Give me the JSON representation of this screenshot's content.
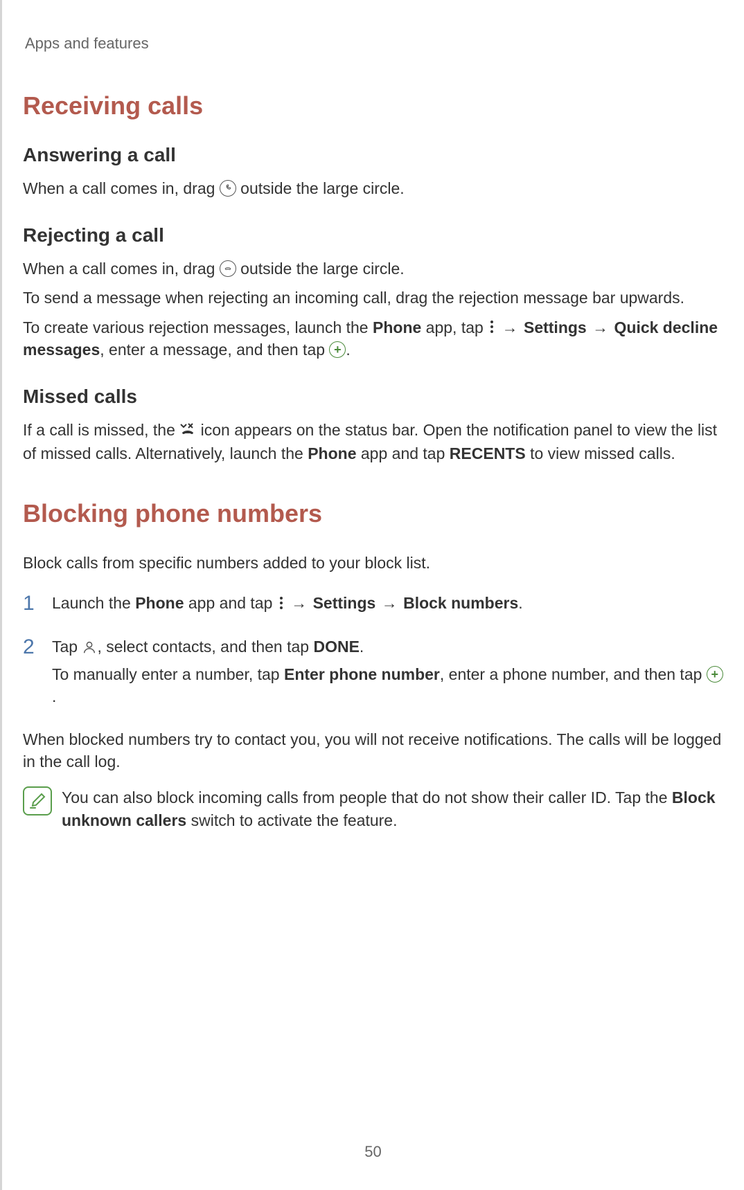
{
  "pageHeader": "Apps and features",
  "section1": {
    "title": "Receiving calls",
    "sub1": {
      "title": "Answering a call",
      "p1a": "When a call comes in, drag ",
      "p1b": " outside the large circle."
    },
    "sub2": {
      "title": "Rejecting a call",
      "p1a": "When a call comes in, drag ",
      "p1b": " outside the large circle.",
      "p2": "To send a message when rejecting an incoming call, drag the rejection message bar upwards.",
      "p3a": "To create various rejection messages, launch the ",
      "p3b": "Phone",
      "p3c": " app, tap ",
      "p3d": "Settings",
      "p3e": "Quick decline messages",
      "p3f": ", enter a message, and then tap "
    },
    "sub3": {
      "title": "Missed calls",
      "p1a": "If a call is missed, the ",
      "p1b": " icon appears on the status bar. Open the notification panel to view the list of missed calls. Alternatively, launch the ",
      "p1c": "Phone",
      "p1d": " app and tap ",
      "p1e": "RECENTS",
      "p1f": " to view missed calls."
    }
  },
  "section2": {
    "title": "Blocking phone numbers",
    "intro": "Block calls from specific numbers added to your block list.",
    "step1": {
      "num": "1",
      "a": "Launch the ",
      "b": "Phone",
      "c": " app and tap ",
      "d": "Settings",
      "e": "Block numbers"
    },
    "step2": {
      "num": "2",
      "p1a": "Tap ",
      "p1b": ", select contacts, and then tap ",
      "p1c": "DONE",
      "p2a": "To manually enter a number, tap ",
      "p2b": "Enter phone number",
      "p2c": ", enter a phone number, and then tap "
    },
    "p_after": "When blocked numbers try to contact you, you will not receive notifications. The calls will be logged in the call log.",
    "note": {
      "a": "You can also block incoming calls from people that do not show their caller ID. Tap the ",
      "b": "Block unknown callers",
      "c": " switch to activate the feature."
    }
  },
  "arrow": "→",
  "period": ".",
  "pageNumber": "50"
}
